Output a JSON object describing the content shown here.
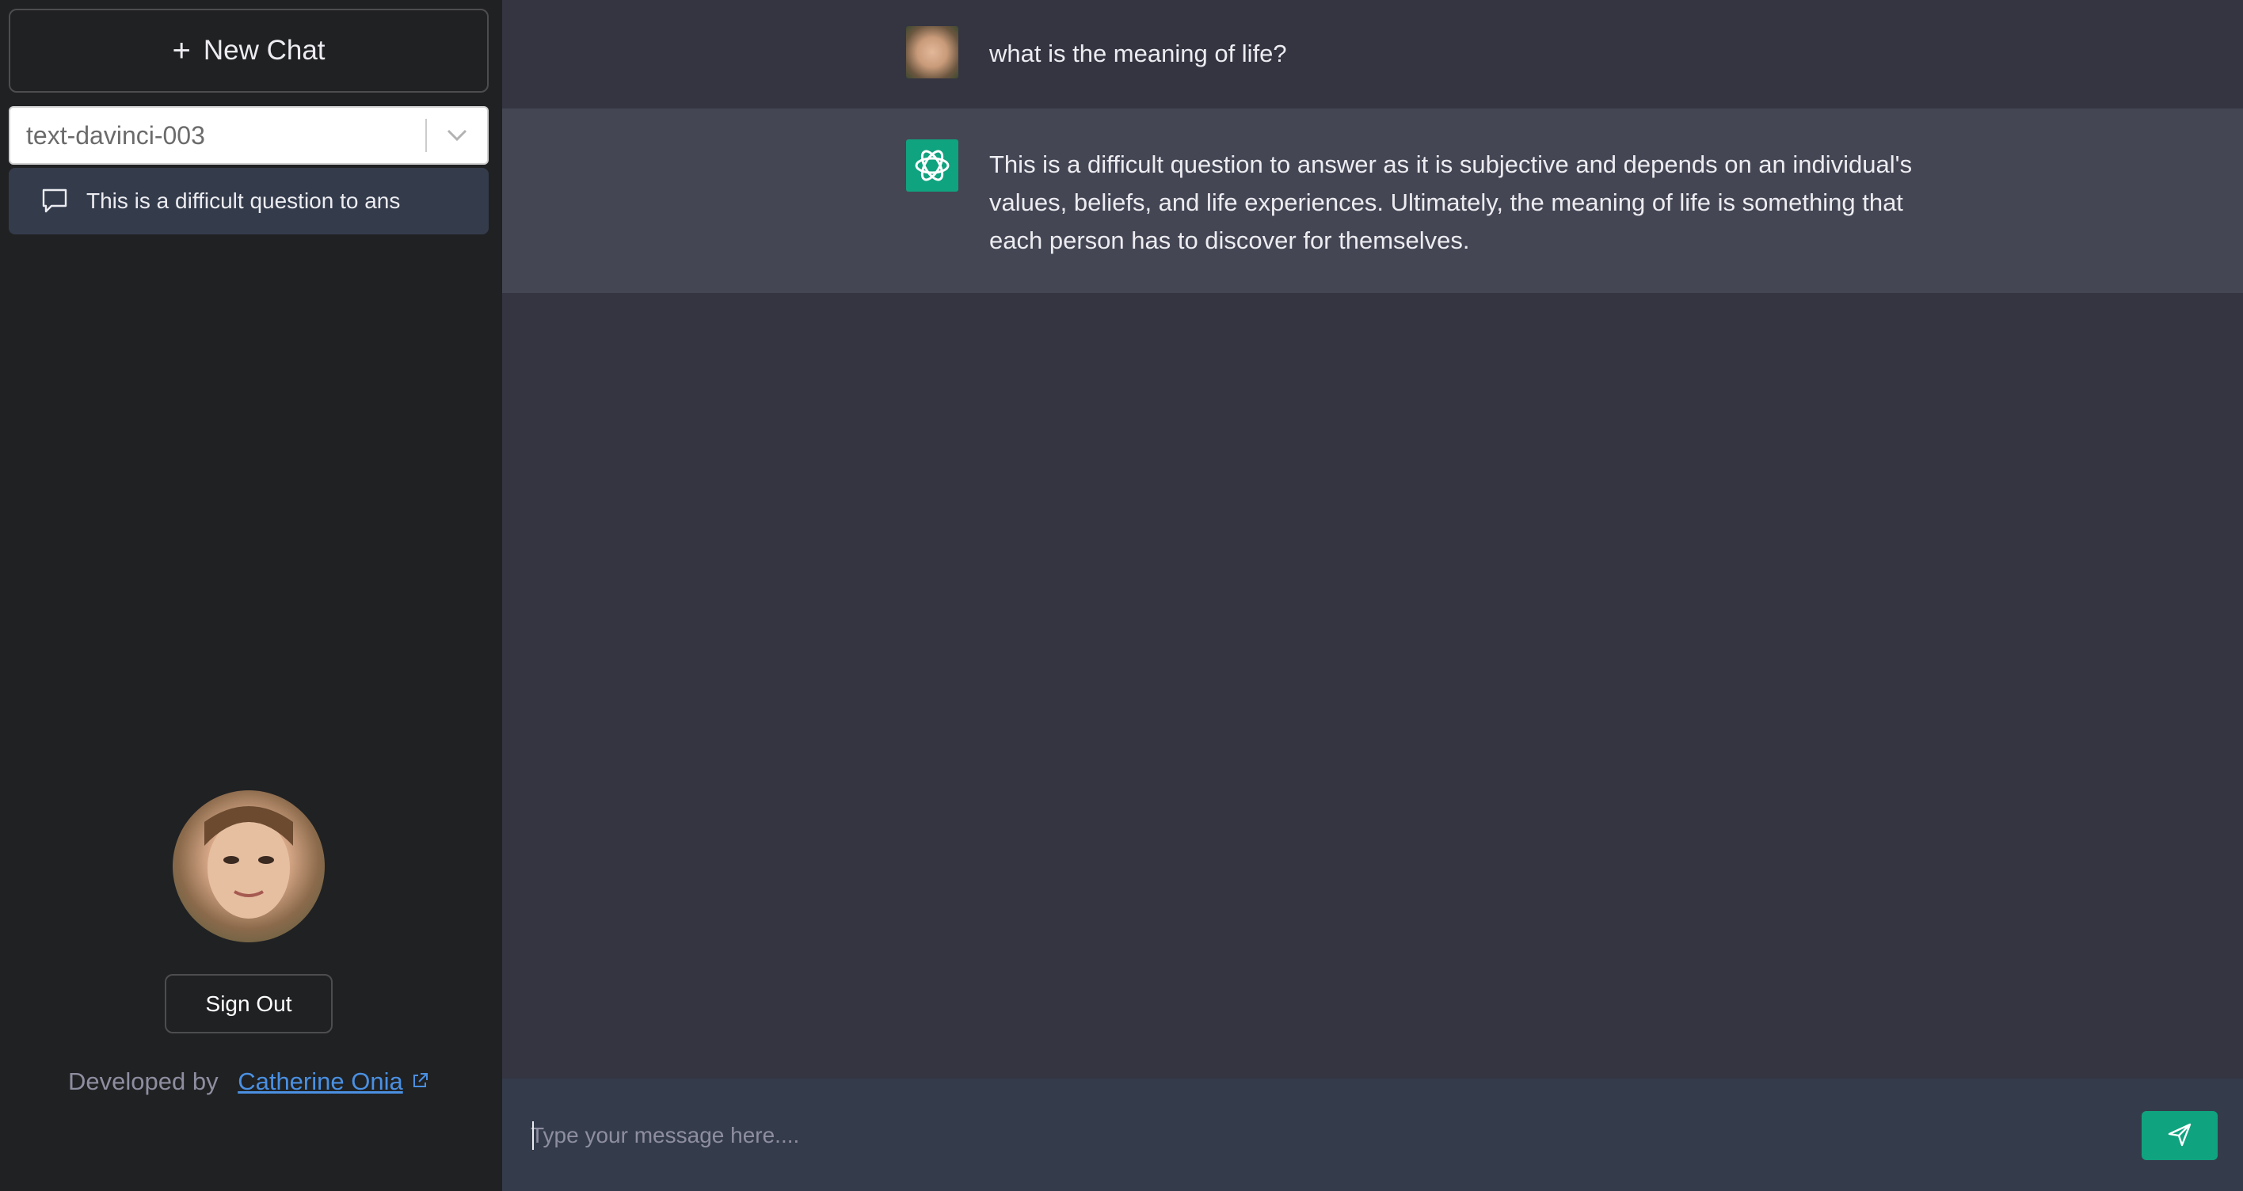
{
  "sidebar": {
    "new_chat_label": "New Chat",
    "model": {
      "selected": "text-davinci-003"
    },
    "history": [
      {
        "label": "This is a difficult question to ans"
      }
    ],
    "sign_out_label": "Sign Out",
    "credit": {
      "prefix": "Developed by",
      "author": "Catherine Onia"
    }
  },
  "conversation": {
    "messages": [
      {
        "role": "user",
        "text": "what is the meaning of life?"
      },
      {
        "role": "assistant",
        "text": "This is a difficult question to answer as it is subjective and depends on an individual's values, beliefs, and life experiences. Ultimately, the meaning of life is something that each person has to discover for themselves."
      }
    ]
  },
  "composer": {
    "placeholder": "Type your message here....",
    "value": ""
  },
  "colors": {
    "sidebar_bg": "#202123",
    "main_bg": "#343541",
    "assistant_row_bg": "#444654",
    "accent": "#10a37f",
    "link": "#4a90e2"
  },
  "icons": [
    "plus-icon",
    "chevron-down-icon",
    "chat-bubble-icon",
    "openai-logo-icon",
    "external-link-icon",
    "send-icon"
  ]
}
